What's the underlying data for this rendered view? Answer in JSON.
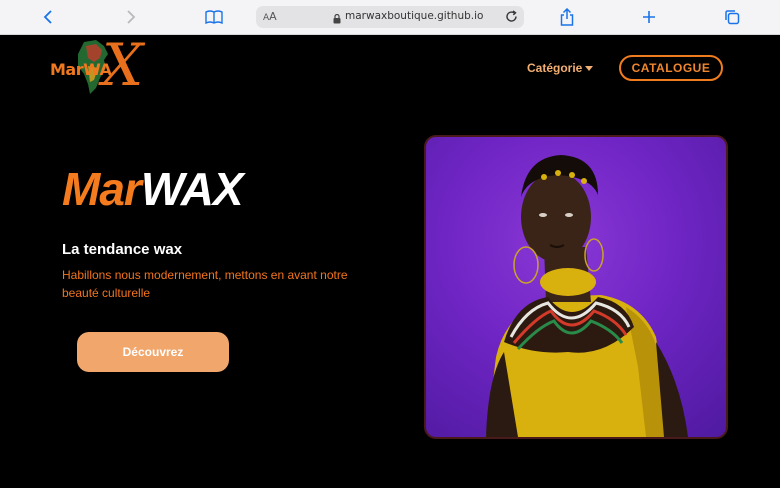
{
  "browser": {
    "url": "marwaxboutique.github.io",
    "text_size_label": "AA"
  },
  "header": {
    "logo_text": "MarWA",
    "logo_x": "X",
    "nav_category": "Catégorie",
    "catalogue_button": "CATALOGUE"
  },
  "hero": {
    "title_part1": "Mar",
    "title_part2": "WAX",
    "tagline": "La tendance wax",
    "description": "Habillons nous modernement, mettons en avant notre beauté culturelle",
    "cta": "Découvrez"
  },
  "colors": {
    "accent": "#f47b1e",
    "button": "#f1a66c",
    "photo_bg": "#6f25c4"
  }
}
